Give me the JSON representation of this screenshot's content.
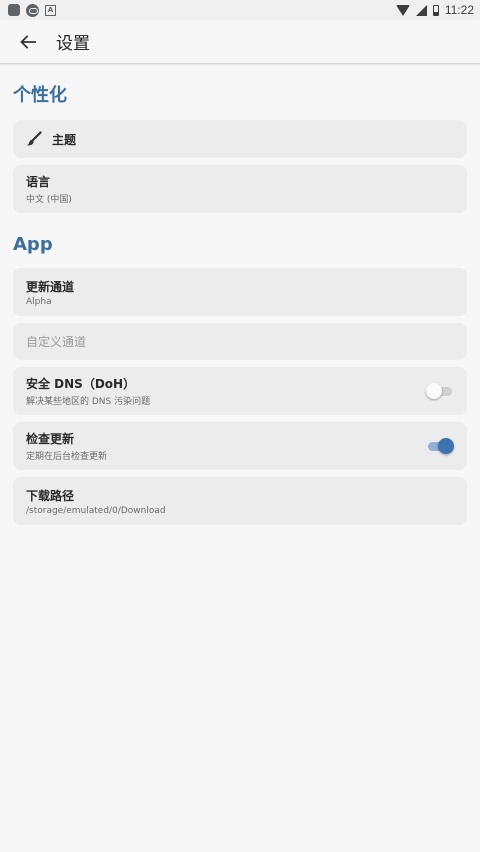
{
  "status_bar": {
    "time": "11:22"
  },
  "app_bar": {
    "title": "设置"
  },
  "sections": [
    {
      "title": "个性化"
    },
    {
      "title": "App"
    }
  ],
  "items": {
    "theme": {
      "label": "主题",
      "icon": "brush-icon"
    },
    "language": {
      "label": "语言",
      "value": "中文 (中国)"
    },
    "update_channel": {
      "label": "更新通道",
      "value": "Alpha"
    },
    "custom_channel": {
      "label": "自定义通道"
    },
    "secure_dns": {
      "label": "安全 DNS（DoH）",
      "description": "解决某些地区的 DNS 污染问题",
      "enabled": false
    },
    "check_updates": {
      "label": "检查更新",
      "description": "定期在后台检查更新",
      "enabled": true
    },
    "download_path": {
      "label": "下载路径",
      "value": "/storage/emulated/0/Download"
    }
  },
  "colors": {
    "accent": "#3d6f9c",
    "toggle_on": "#3d74b0"
  }
}
